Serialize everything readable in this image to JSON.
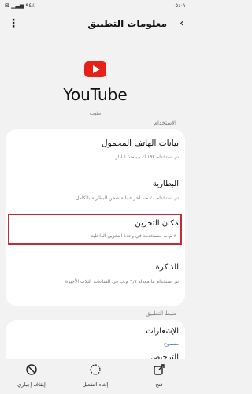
{
  "statusbar": {
    "time": "٥:٠١",
    "icons": "⊠ ▁▃▅ ٩٤٪"
  },
  "header": {
    "title": "معلومات التطبيق",
    "back_glyph": "‹",
    "more_glyph": "⋮"
  },
  "app": {
    "name": "YouTube",
    "status": "مثبت",
    "brand_color": "#e62117"
  },
  "usage": {
    "label": "الاستخدام",
    "items": [
      {
        "title": "بيانات الهاتف المحمول",
        "subtitle": "تم استخدام ١٩٢ ك.ب منذ ١ آذار"
      },
      {
        "title": "البطارية",
        "subtitle": "تم استخدام ٠٪ منذ آخر عملية شحن البطارية بالكامل"
      },
      {
        "title": "مكان التخزين",
        "subtitle": "٨٠ م.ب مستخدمة في وحدة التخزين الداخلية"
      },
      {
        "title": "الذاكرة",
        "subtitle": "تم استخدام ما معدله ٦٫٩ م.ب في الساعات الثلاث الأخيرة"
      }
    ]
  },
  "settings": {
    "label": "ضبط التطبيق",
    "items": [
      {
        "title": "الإشعارات",
        "subtitle": "مسموح"
      },
      {
        "title": "الترخيص",
        "subtitle": ""
      }
    ]
  },
  "bottom": {
    "open": "فتح",
    "disable": "إلغاء التفعيل",
    "force_stop": "إيقاف إجباري"
  },
  "highlight_color": "#c22c36"
}
